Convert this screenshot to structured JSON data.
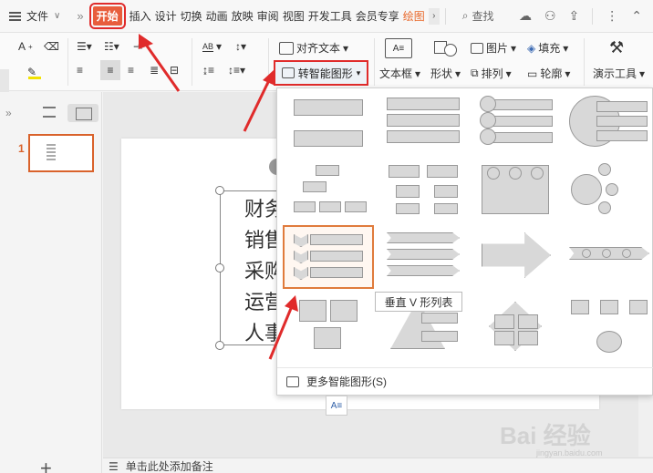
{
  "menubar": {
    "file_label": "文件",
    "tabs": [
      "开始",
      "插入",
      "设计",
      "切换",
      "动画",
      "放映",
      "审阅",
      "视图",
      "开发工具",
      "会员专享",
      "绘图"
    ],
    "active_tab": "开始",
    "search_label": "查找"
  },
  "ribbon": {
    "align_text": "对齐文本",
    "convert_smartart": "转智能图形",
    "textbox": "文本框",
    "shape": "形状",
    "arrange": "排列",
    "picture": "图片",
    "fill": "填充",
    "outline": "轮廓",
    "presentation_tools": "演示工具"
  },
  "slides": {
    "current": "1"
  },
  "slide_content": {
    "lines": [
      "财务部",
      "销售部",
      "采购部",
      "运营部",
      "人事部"
    ]
  },
  "notes": {
    "placeholder": "单击此处添加备注"
  },
  "smartart_menu": {
    "tooltip": "垂直 V 形列表",
    "more_label": "更多智能图形(S)"
  },
  "watermark": {
    "text": "Bai 经验",
    "url": "jingyan.baidu.com"
  }
}
